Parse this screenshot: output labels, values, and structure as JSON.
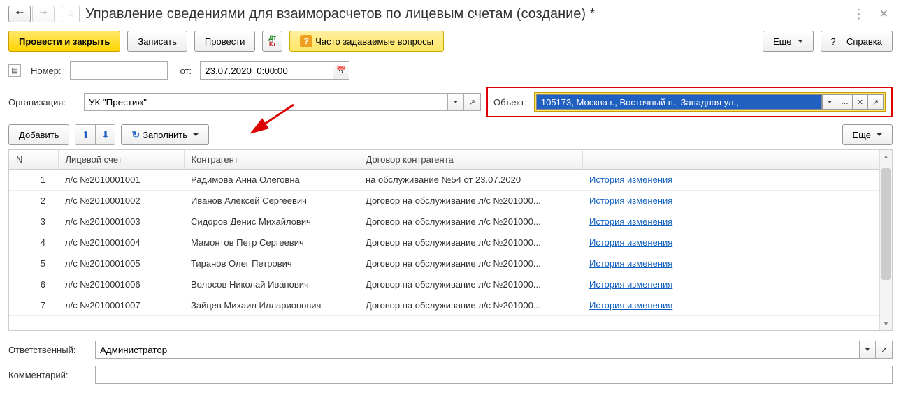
{
  "header": {
    "title": "Управление сведениями для взаиморасчетов по лицевым счетам (создание) *"
  },
  "toolbar": {
    "post_close": "Провести и закрыть",
    "write": "Записать",
    "post": "Провести",
    "faq": "Часто задаваемые вопросы",
    "more": "Еще",
    "help": "Справка",
    "help_q": "?"
  },
  "form": {
    "number_label": "Номер:",
    "number_value": "",
    "from_label": "от:",
    "date_value": "23.07.2020  0:00:00",
    "org_label": "Организация:",
    "org_value": "УК \"Престиж\"",
    "object_label": "Объект:",
    "object_value": "105173, Москва г., Восточный п., Западная ул.,",
    "responsible_label": "Ответственный:",
    "responsible_value": "Администратор",
    "comment_label": "Комментарий:",
    "comment_value": ""
  },
  "subtoolbar": {
    "add": "Добавить",
    "fill": "Заполнить",
    "more": "Еще"
  },
  "table": {
    "headers": [
      "N",
      "Лицевой счет",
      "Контрагент",
      "Договор контрагента",
      ""
    ],
    "rows": [
      {
        "n": "1",
        "acc": "л/с №2010001001",
        "cnt": "Радимова Анна Олеговна",
        "dog": "на обслуживание №54 от 23.07.2020",
        "hist": "История изменения"
      },
      {
        "n": "2",
        "acc": "л/с №2010001002",
        "cnt": "Иванов Алексей Сергеевич",
        "dog": "Договор на обслуживание л/с №201000...",
        "hist": "История изменения"
      },
      {
        "n": "3",
        "acc": "л/с №2010001003",
        "cnt": "Сидоров Денис Михайлович",
        "dog": "Договор на обслуживание л/с №201000...",
        "hist": "История изменения"
      },
      {
        "n": "4",
        "acc": "л/с №2010001004",
        "cnt": "Мамонтов Петр Сергеевич",
        "dog": "Договор на обслуживание л/с №201000...",
        "hist": "История изменения"
      },
      {
        "n": "5",
        "acc": "л/с №2010001005",
        "cnt": "Тиранов Олег Петрович",
        "dog": "Договор на обслуживание л/с №201000...",
        "hist": "История изменения"
      },
      {
        "n": "6",
        "acc": "л/с №2010001006",
        "cnt": "Волосов Николай Иванович",
        "dog": "Договор на обслуживание л/с №201000...",
        "hist": "История изменения"
      },
      {
        "n": "7",
        "acc": "л/с №2010001007",
        "cnt": "Зайцев Михаил Илларионович",
        "dog": "Договор на обслуживание л/с №201000...",
        "hist": "История изменения"
      }
    ]
  }
}
